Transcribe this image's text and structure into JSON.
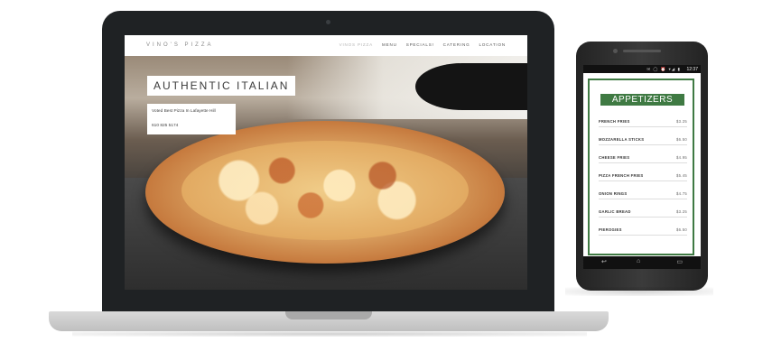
{
  "laptop_site": {
    "logo": "VINO'S PIZZA",
    "nav": [
      "VINOS PIZZA",
      "MENU",
      "SPECIALS!",
      "CATERING",
      "LOCATION"
    ],
    "hero_title": "AUTHENTIC ITALIAN",
    "tagline": "Voted Best Pizza In Lafayette Hill",
    "phone": "610 825 5174"
  },
  "phone": {
    "status_icons": "✉ ◯ ⏰ ▾◢ ▮",
    "status_time": "12:37",
    "menu_title": "APPETIZERS",
    "items": [
      {
        "name": "FRENCH FRIES",
        "price": "$3.25"
      },
      {
        "name": "MOZZARELLA STICKS",
        "price": "$6.50"
      },
      {
        "name": "CHEESE FRIES",
        "price": "$4.95"
      },
      {
        "name": "PIZZA FRENCH FRIES",
        "price": "$5.45"
      },
      {
        "name": "ONION RINGS",
        "price": "$4.75"
      },
      {
        "name": "GARLIC BREAD",
        "price": "$3.25"
      },
      {
        "name": "PIEROGIES",
        "price": "$6.50"
      }
    ],
    "nav_back": "↩",
    "nav_home": "⌂",
    "nav_recent": "▭"
  },
  "colors": {
    "accent_green": "#3f7a43",
    "device_dark": "#1f2224",
    "laptop_silver": "#c9c9c9"
  }
}
